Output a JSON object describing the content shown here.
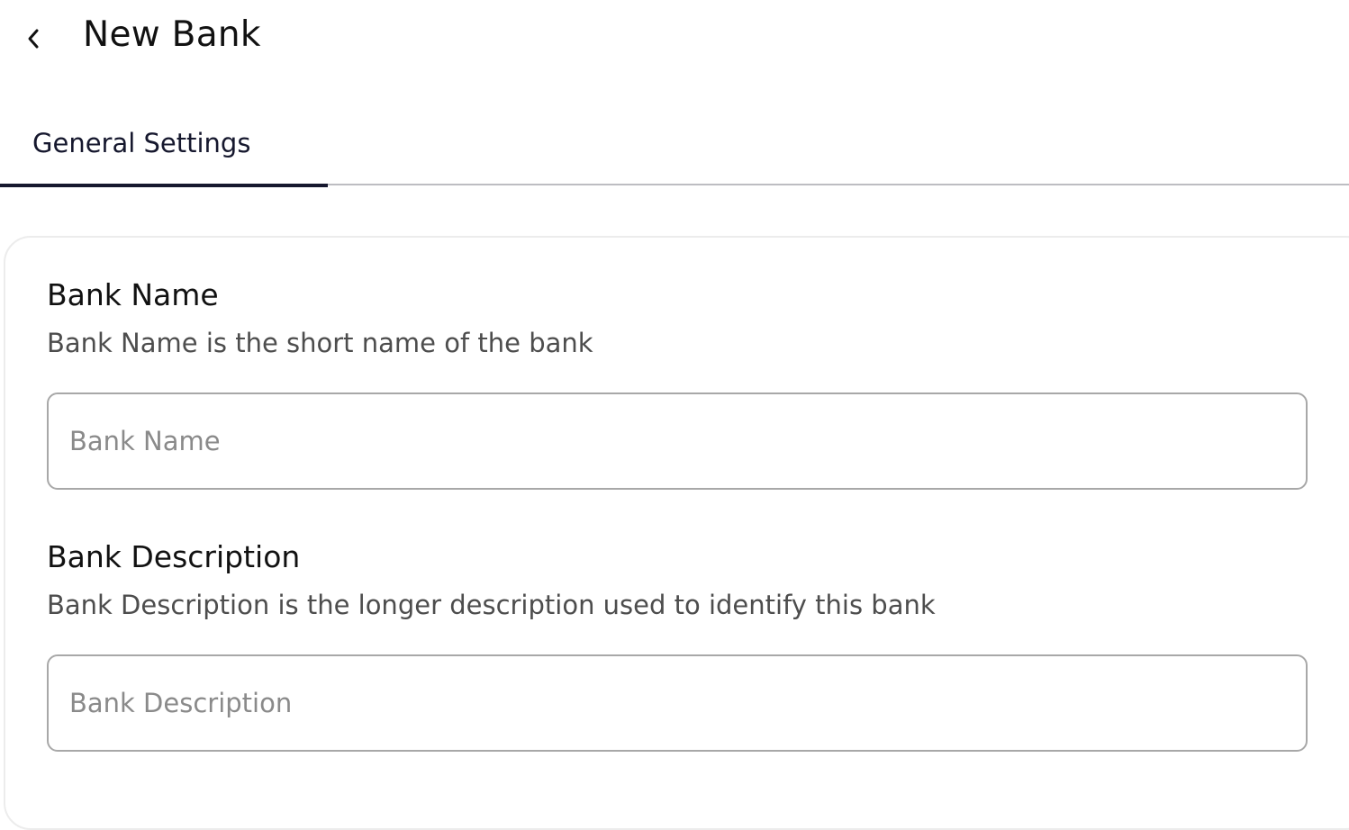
{
  "header": {
    "title": "New Bank",
    "back_icon": "chevron-left-icon"
  },
  "tabs": [
    {
      "label": "General Settings",
      "active": true
    }
  ],
  "form": {
    "bank_name": {
      "label": "Bank Name",
      "description": "Bank Name is the short name of the bank",
      "placeholder": "Bank Name",
      "value": ""
    },
    "bank_description": {
      "label": "Bank Description",
      "description": "Bank Description is the longer description used to identify this bank",
      "placeholder": "Bank Description",
      "value": ""
    }
  },
  "colors": {
    "accent": "#16182e",
    "tab_divider": "#bdbdc2",
    "input_border": "#a8a8a8"
  }
}
